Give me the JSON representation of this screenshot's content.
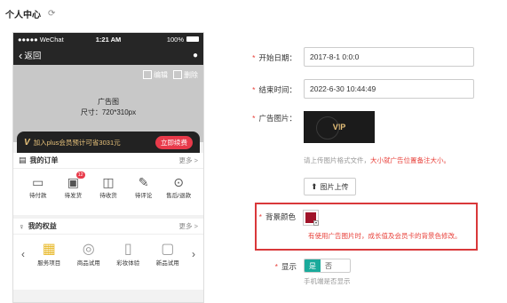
{
  "page": {
    "title": "个人中心",
    "refresh_icon": "refresh-icon"
  },
  "phone": {
    "status": {
      "carrier": "●●●●● WeChat",
      "time": "1:21 AM",
      "battery": "100%"
    },
    "nav": {
      "back_label": "返回"
    },
    "ad": {
      "edit_label": "编辑",
      "delete_label": "删除",
      "title": "广告图",
      "size": "尺寸：720*310px"
    },
    "plus": {
      "text": "加入plus会员预计可省3031元",
      "renew_label": "立即续费"
    },
    "orders": {
      "title": "我的订单",
      "more": "更多 >",
      "items": [
        {
          "label": "待付款",
          "icon": "wallet-icon"
        },
        {
          "label": "待发货",
          "icon": "truck-icon",
          "badge": "12"
        },
        {
          "label": "待收货",
          "icon": "package-icon"
        },
        {
          "label": "待评论",
          "icon": "comment-icon"
        },
        {
          "label": "售后/退款",
          "icon": "refund-icon"
        }
      ]
    },
    "benefits": {
      "title": "我的权益",
      "more": "更多 >",
      "items": [
        {
          "label": "服务项目",
          "icon": "gift-icon"
        },
        {
          "label": "商品试用",
          "icon": "database-icon"
        },
        {
          "label": "彩妆体验",
          "icon": "bottle-icon"
        },
        {
          "label": "新品试用",
          "icon": "product-icon"
        }
      ]
    }
  },
  "form": {
    "start_date": {
      "label": "开始日期：",
      "value": "2017-8-1 0:0:0"
    },
    "end_time": {
      "label": "结束时间：",
      "value": "2022-6-30 10:44:49"
    },
    "ad_image": {
      "label": "广告图片：",
      "vip_text": "VIP",
      "hint_prefix": "请上传图片格式文件，",
      "hint_red": "大小就广告位置备注大小。",
      "upload_label": "图片上传"
    },
    "bg_color": {
      "label": "背景颜色",
      "color": "#a0142a",
      "hint": "有使用广告图片时，成长值及会员卡的背景色修改。"
    },
    "display": {
      "label": "显示",
      "on_label": "是",
      "off_label": "否",
      "hint": "手机端是否显示"
    }
  }
}
